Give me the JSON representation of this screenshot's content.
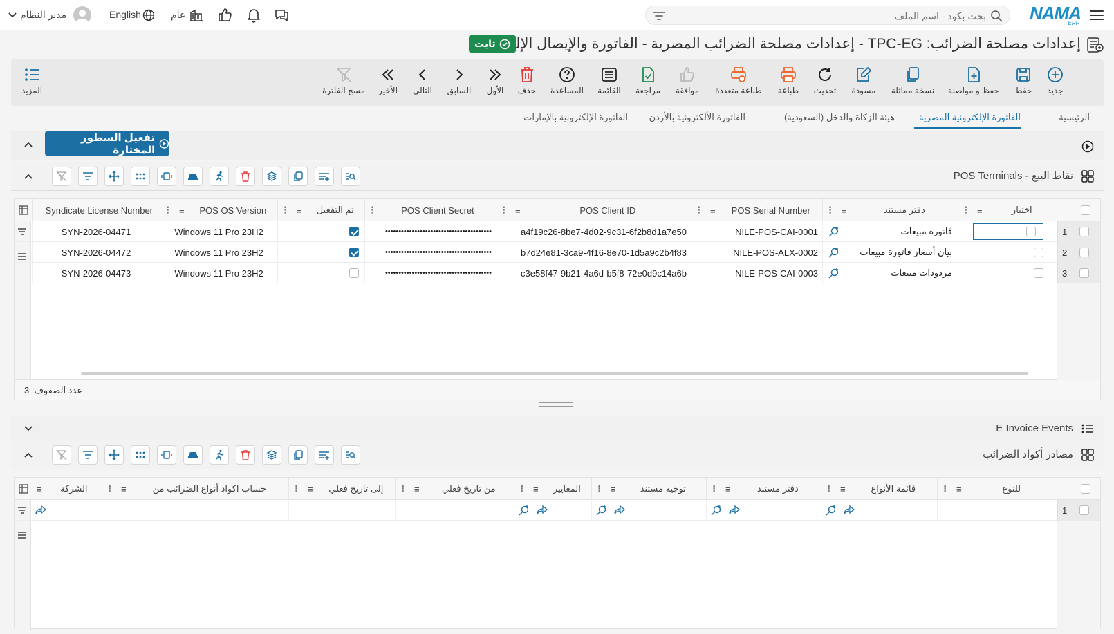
{
  "topbar": {
    "logo": "NAMA",
    "logo_sub": "ERP",
    "search_placeholder": "بحث بكود - اسم الملف",
    "user_name": "مدير النظام",
    "language": "English",
    "company": "عام"
  },
  "page": {
    "title": "إعدادات مصلحة الضرائب: TPC-EG - إعدادات مصلحة الضرائب المصرية - الفاتورة والإيصال الإلكتروني",
    "status_badge": "ثابت"
  },
  "toolbar": {
    "new": "جديد",
    "save": "حفظ",
    "save_continue": "حفظ و مواصلة",
    "duplicate": "نسخة مماثلة",
    "draft": "مسودة",
    "refresh": "تحديث",
    "print": "طباعة",
    "multi_print": "طباعة متعددة",
    "approve": "موافقة",
    "review": "مراجعة",
    "list": "القائمة",
    "help": "المساعدة",
    "delete": "حذف",
    "first": "الأول",
    "previous": "السابق",
    "next": "التالي",
    "last": "الأخير",
    "clear_filter": "مسح الفلترة",
    "more": "المزيد"
  },
  "tabs": [
    "الرئيسية",
    "الفاتورة الإلكترونية المصرية",
    "هيئة الزكاة والدخل (السعودية)",
    "الفاتورة الألكترونية بالأردن",
    "الفاتورة الإلكترونية بالإمارات"
  ],
  "activate_button": "تفعيل السطور المختارة",
  "pos_grid": {
    "title": "POS Terminals - نقاط البيع",
    "columns": [
      "اختيار",
      "دفتر مستند",
      "POS Serial Number",
      "POS Client ID",
      "POS Client Secret",
      "تم التفعيل",
      "POS OS Version",
      "Syndicate License Number"
    ],
    "rows": [
      {
        "num": "1",
        "book": "فاتورة مبيعات",
        "serial": "NILE-POS-CAI-0001",
        "client_id": "a4f19c26-8be7-4d02-9c31-6f2b8d1a7e50",
        "secret": "••••••••••••••••••••••••••••••••••••••••",
        "activated": true,
        "os": "Windows 11 Pro 23H2",
        "license": "SYN-2026-04471"
      },
      {
        "num": "2",
        "book": "بيان أسعار فاتورة مبيعات",
        "serial": "NILE-POS-ALX-0002",
        "client_id": "b7d24e81-3ca9-4f16-8e70-1d5a9c2b4f83",
        "secret": "••••••••••••••••••••••••••••••••••••••••",
        "activated": true,
        "os": "Windows 11 Pro 23H2",
        "license": "SYN-2026-04472"
      },
      {
        "num": "3",
        "book": "مردودات مبيعات",
        "serial": "NILE-POS-CAI-0003",
        "client_id": "c3e58f47-9b21-4a6d-b5f8-72e0d9c14a6b",
        "secret": "••••••••••••••••••••••••••••••••••••••••",
        "activated": false,
        "os": "Windows 11 Pro 23H2",
        "license": "SYN-2026-04473"
      }
    ],
    "row_count": "عدد الصفوف: 3"
  },
  "events_bar": "E Invoice Events",
  "tax_grid": {
    "title": "مصادر أكواد الضرائب",
    "columns": [
      "للنوع",
      "قائمة الأنواع",
      "دفتر مستند",
      "توجيه مستند",
      "المعايير",
      "من تاريخ فعلي",
      "إلى تاريخ فعلي",
      "حساب اكواد أنواع الضرائب من",
      "الشركة"
    ],
    "rows": [
      {
        "num": "1"
      }
    ]
  },
  "colors": {
    "accent": "#1b6fa3",
    "badge": "#1e8c4e",
    "danger": "#e53935",
    "print": "#f0652b"
  }
}
